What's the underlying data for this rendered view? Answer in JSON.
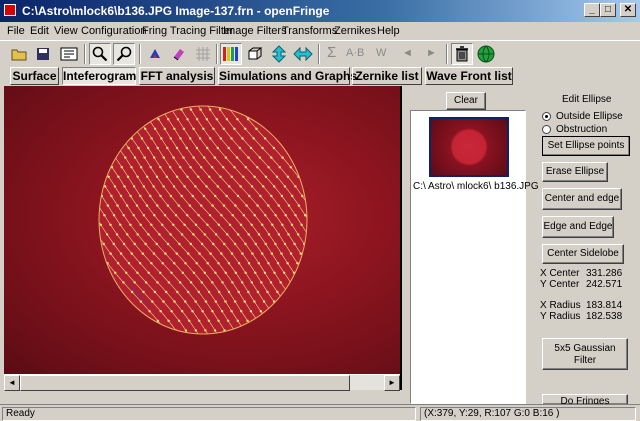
{
  "window": {
    "title": "C:\\Astro\\mlock6\\b136.JPG Image-137.frn - openFringe",
    "minimize": "_",
    "maximize": "□",
    "close": "✕"
  },
  "menu": [
    "File",
    "Edit",
    "View",
    "Configuration",
    "Fring Tracing Filter",
    "Image Filters",
    "Transforms",
    "Zernikes",
    "Help"
  ],
  "toolbar": {
    "icons": [
      "open-icon",
      "save-icon",
      "export-icon",
      "zoom-in-icon",
      "zoom-out-icon",
      "fill-icon",
      "erase-icon",
      "grid-icon",
      "color-bars-icon",
      "cube-icon",
      "vertical-arrow-icon",
      "horizontal-arrow-icon",
      "sum-icon",
      "trash-icon",
      "globe-icon"
    ],
    "sum_label": "Σ",
    "ab_label": "A·B",
    "w_label": "W",
    "prev_label": "◄",
    "next_label": "►"
  },
  "tabs": [
    "Surface",
    "Inteferogram",
    "FFT analysis",
    "Simulations and Graphs",
    "Zernike list",
    "Wave Front list"
  ],
  "active_tab": "Inteferogram",
  "thumbnails": {
    "clear_label": "Clear",
    "items": [
      {
        "label": "C:\\ Astro\\ mlock6\\ b136.JPG"
      }
    ]
  },
  "ellipse": {
    "title": "Edit Ellipse",
    "outside_label": "Outside Ellipse",
    "obstruction_label": "Obstruction",
    "selected": "outside",
    "set_points": "Set Ellipse points",
    "erase": "Erase Ellipse",
    "center_edge": "Center and edge",
    "edge_edge": "Edge and Edge",
    "center_sidelobe": "Center Sidelobe",
    "x_center_label": "X Center",
    "x_center_value": "331.286",
    "y_center_label": "Y Center",
    "y_center_value": "242.571",
    "x_radius_label": "X Radius",
    "x_radius_value": "183.814",
    "y_radius_label": "Y Radius",
    "y_radius_value": "182.538",
    "gaussian": "5x5 Gaussian Filter",
    "do_fringes": "Do Fringes"
  },
  "status": {
    "ready": "Ready",
    "cursor": "(X:379, Y:29, R:107 G:0 B:16 )"
  },
  "colors": {
    "fringe_dot": "#f5e27a",
    "ellipse": "#e8b060",
    "title_start": "#0a246a",
    "title_end": "#a6caf0"
  }
}
